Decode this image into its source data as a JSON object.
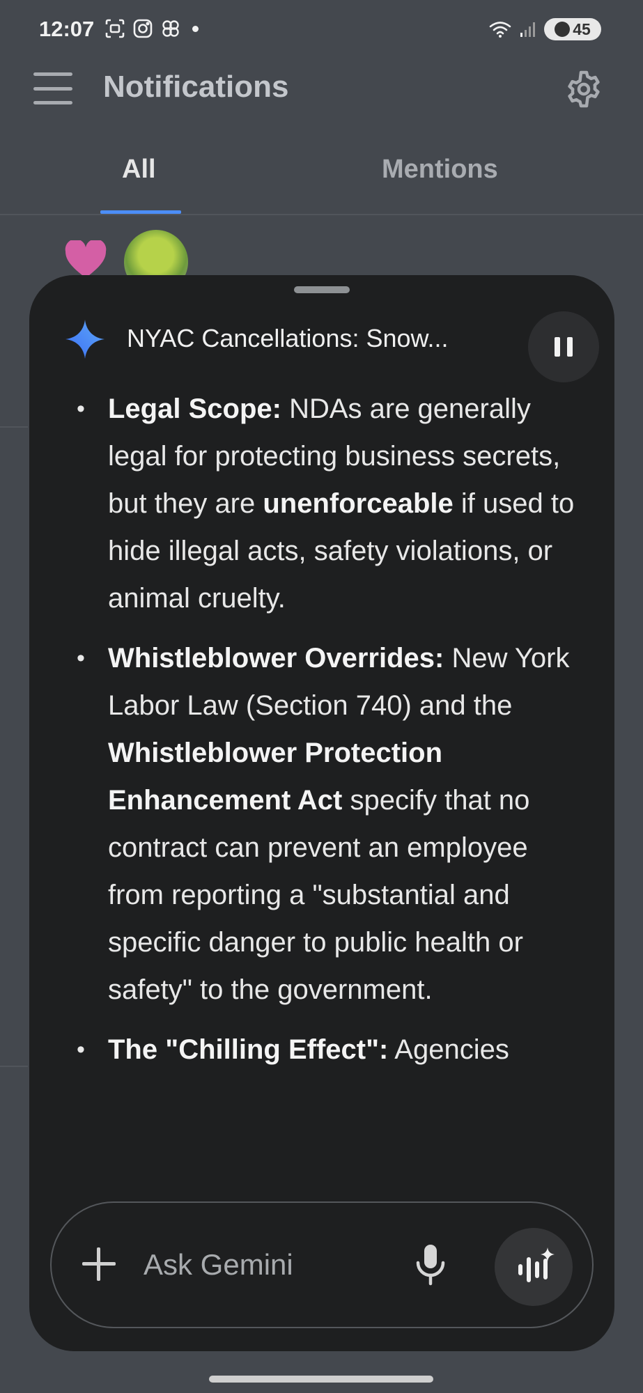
{
  "status_bar": {
    "time": "12:07",
    "battery": "45",
    "left_icons": [
      "screenshot-icon",
      "instagram-icon",
      "flower-icon",
      "dot-icon"
    ],
    "right_icons": [
      "wifi-icon",
      "signal-icon",
      "battery-icon"
    ]
  },
  "app_bar": {
    "title": "Notifications",
    "menu_icon": "hamburger-menu-icon",
    "settings_icon": "gear-icon"
  },
  "tabs": [
    {
      "label": "All",
      "selected": true
    },
    {
      "label": "Mentions",
      "selected": false
    }
  ],
  "gemini_panel": {
    "title": "NYAC Cancellations: Snow...",
    "bullets": [
      {
        "parts": [
          {
            "text": "Legal Scope:",
            "bold": true
          },
          {
            "text": " NDAs are generally legal for protecting business secrets, but they are ",
            "bold": false
          },
          {
            "text": "unenforceable",
            "bold": true
          },
          {
            "text": " if used to hide illegal acts, safety violations, or animal cruelty.",
            "bold": false
          }
        ]
      },
      {
        "parts": [
          {
            "text": "Whistleblower Overrides:",
            "bold": true
          },
          {
            "text": " New York Labor Law (Section 740) and the ",
            "bold": false
          },
          {
            "text": "Whistleblower Protection Enhancement Act",
            "bold": true
          },
          {
            "text": " specify that no contract can prevent an employee from reporting a \"substantial and specific danger to public health or safety\" to the government.",
            "bold": false
          }
        ]
      },
      {
        "parts": [
          {
            "text": "The \"Chilling Effect\":",
            "bold": true
          },
          {
            "text": " Agencies",
            "bold": false
          }
        ]
      }
    ],
    "input": {
      "placeholder": "Ask Gemini"
    }
  },
  "colors": {
    "background": "#44484e",
    "panel": "#1e1f20",
    "tab_indicator": "#4c8ef7"
  }
}
